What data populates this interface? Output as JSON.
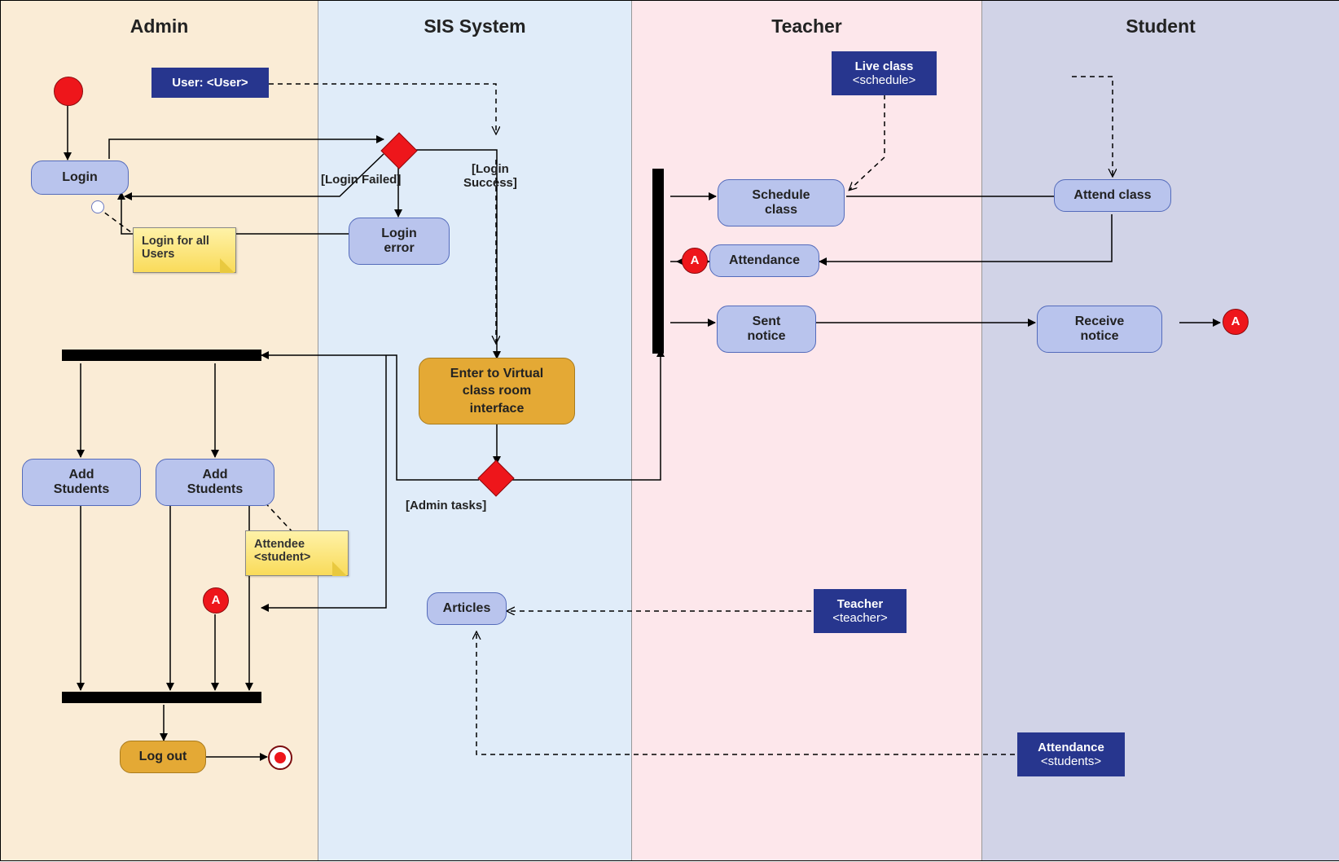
{
  "lanes": {
    "admin": "Admin",
    "sis": "SIS System",
    "teacher": "Teacher",
    "student": "Student"
  },
  "signals": {
    "user": "User: <User>",
    "liveclass_l1": "Live class",
    "liveclass_l2": "<schedule>",
    "teacher_l1": "Teacher",
    "teacher_l2": "<teacher>",
    "attendance_l1": "Attendance",
    "attendance_l2": "<students>"
  },
  "activities": {
    "login": "Login",
    "loginerror": "Login error",
    "enter": "Enter to Virtual class room interface",
    "add1": "Add Students",
    "add2": "Add Students",
    "articles": "Articles",
    "logout": "Log out",
    "schedule": "Schedule class",
    "attend": "Attend class",
    "attendance": "Attendance",
    "sent": "Sent notice",
    "receive": "Receive notice"
  },
  "notes": {
    "loginall": "Login for all Users",
    "attendee_l1": "Attendee",
    "attendee_l2": "<student>"
  },
  "guards": {
    "failed": "[Login Failed]",
    "success_l1": "[Login",
    "success_l2": "Success]",
    "admin": "[Admin tasks]"
  },
  "connector": "A"
}
